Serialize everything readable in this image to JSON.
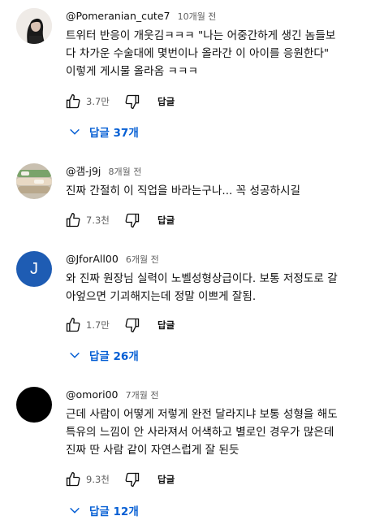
{
  "comments": [
    {
      "author": "@Pomeranian_cute7",
      "time": "10개월 전",
      "text_lines": [
        "트위터 반응이 개웃김ㅋㅋㅋ \"나는 어중간하게 생긴 놈들보",
        "다 차가운 수술대에 몇번이나 올라간 이 아이를 응원한다\"",
        "이렇게 게시물 올라옴 ㅋㅋㅋ"
      ],
      "likes": "3.7만",
      "reply_label": "답글",
      "replies_label": "답글 37개",
      "avatar_icon": "profile-photo-dark-hair"
    },
    {
      "author": "@갬-j9j",
      "time": "8개월 전",
      "text_lines": [
        "진짜 간절히 이 직업을 바라는구나... 꼭 성공하시길"
      ],
      "likes": "7.3천",
      "reply_label": "답글",
      "avatar_icon": "profile-photo-sushi"
    },
    {
      "author": "@JforAll00",
      "time": "6개월 전",
      "text_lines": [
        "와 진짜 원장님 실력이 노벨성형상급이다. 보통 저정도로 갈",
        "아엎으면 기괴해지는데 정말 이쁘게 잘됨."
      ],
      "likes": "1.7만",
      "reply_label": "답글",
      "replies_label": "답글 26개",
      "avatar_letter": "J",
      "avatar_color": "#1e5cb3"
    },
    {
      "author": "@omori00",
      "time": "7개월 전",
      "text_lines": [
        "근데 사람이 어떻게 저렇게 완전 달라지냐 보통 성형을 해도",
        "특유의 느낌이 안 사라져서 어색하고 별로인 경우가 많은데",
        "진짜 딴 사람 같이 자연스럽게 잘 된듯"
      ],
      "likes": "9.3천",
      "reply_label": "답글",
      "replies_label": "답글 12개",
      "avatar_color": "#000000"
    }
  ],
  "colors": {
    "link_blue": "#065fd4",
    "secondary_text": "#606060"
  }
}
